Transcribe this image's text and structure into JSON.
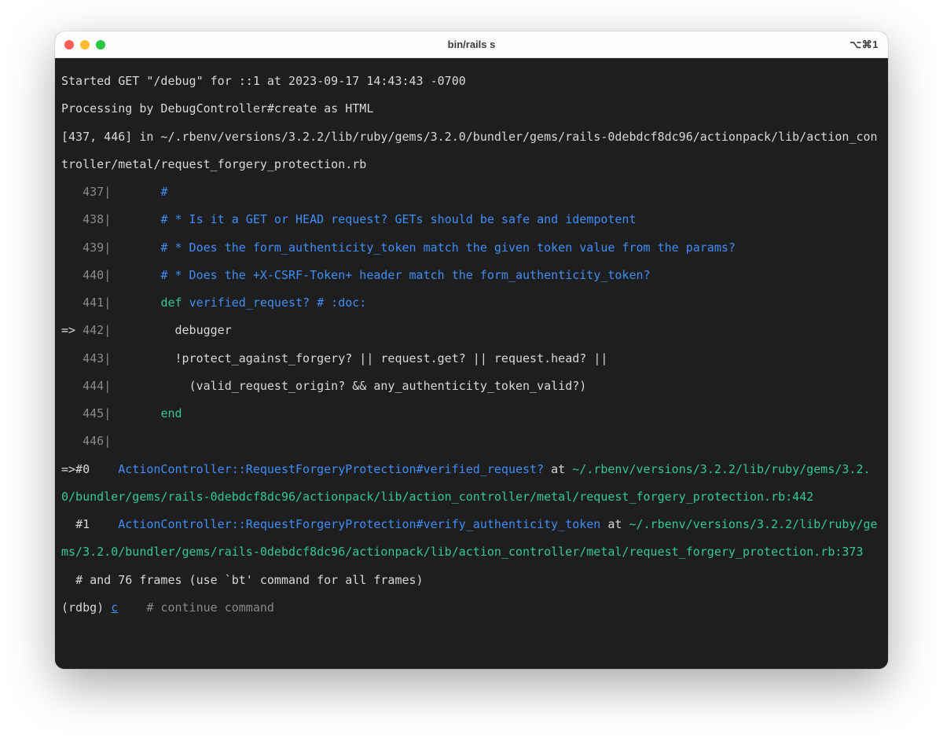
{
  "titlebar": {
    "title": "bin/rails s",
    "shortcut": "⌥⌘1"
  },
  "colors": {
    "bg": "#1e1e1e",
    "text": "#d8d8d8",
    "dim": "#8a8a8a",
    "blue": "#3f8ef7",
    "green": "#34c89a"
  },
  "log": {
    "request_line": "Started GET \"/debug\" for ::1 at 2023-09-17 14:43:43 -0700",
    "processing_line": "Processing by DebugController#create as HTML",
    "source_header": "[437, 446] in ~/.rbenv/versions/3.2.2/lib/ruby/gems/3.2.0/bundler/gems/rails-0debdcf8dc96/actionpack/lib/action_controller/metal/request_forgery_protection.rb"
  },
  "source": [
    {
      "n": "437",
      "prefix": "   ",
      "segments": [
        {
          "pad": "       ",
          "cls": "comment",
          "text": "#"
        }
      ]
    },
    {
      "n": "438",
      "prefix": "   ",
      "segments": [
        {
          "pad": "       ",
          "cls": "comment",
          "text": "# * Is it a GET or HEAD request? GETs should be safe and idempotent"
        }
      ]
    },
    {
      "n": "439",
      "prefix": "   ",
      "segments": [
        {
          "pad": "       ",
          "cls": "comment",
          "text": "# * Does the form_authenticity_token match the given token value from the params?"
        }
      ]
    },
    {
      "n": "440",
      "prefix": "   ",
      "segments": [
        {
          "pad": "       ",
          "cls": "comment",
          "text": "# * Does the +X-CSRF-Token+ header match the form_authenticity_token?"
        }
      ]
    },
    {
      "n": "441",
      "prefix": "   ",
      "segments": [
        {
          "pad": "       ",
          "cls": "kw",
          "text": "def"
        },
        {
          "pad": " ",
          "cls": "method",
          "text": "verified_request?"
        },
        {
          "pad": " ",
          "cls": "comment",
          "text": "# :doc:"
        }
      ]
    },
    {
      "n": "442",
      "prefix": "=> ",
      "segments": [
        {
          "pad": "         ",
          "cls": "",
          "text": "debugger"
        }
      ]
    },
    {
      "n": "443",
      "prefix": "   ",
      "segments": [
        {
          "pad": "         ",
          "cls": "",
          "text": "!protect_against_forgery? || request.get? || request.head? ||"
        }
      ]
    },
    {
      "n": "444",
      "prefix": "   ",
      "segments": [
        {
          "pad": "           ",
          "cls": "",
          "text": "(valid_request_origin? && any_authenticity_token_valid?)"
        }
      ]
    },
    {
      "n": "445",
      "prefix": "   ",
      "segments": [
        {
          "pad": "       ",
          "cls": "kw",
          "text": "end"
        }
      ]
    },
    {
      "n": "446",
      "prefix": "   ",
      "segments": []
    }
  ],
  "frames": [
    {
      "prefix": "=>#0",
      "indent": "",
      "method": "ActionController::RequestForgeryProtection#verified_request?",
      "at": " at ",
      "path": "~/.rbenv/versions/3.2.2/lib/ruby/gems/3.2.0/bundler/gems/rails-0debdcf8dc96/actionpack/lib/action_controller/metal/request_forgery_protection.rb:442"
    },
    {
      "prefix": "  #1",
      "indent": "",
      "method": "ActionController::RequestForgeryProtection#verify_authenticity_token",
      "at": " at ",
      "path": "~/.rbenv/versions/3.2.2/lib/ruby/gems/3.2.0/bundler/gems/rails-0debdcf8dc96/actionpack/lib/action_controller/metal/request_forgery_protection.rb:373"
    }
  ],
  "frames_note": "  # and 76 frames (use `bt' command for all frames)",
  "prompt": {
    "label": "(rdbg) ",
    "cmd": "c",
    "hint": "    # continue command"
  }
}
